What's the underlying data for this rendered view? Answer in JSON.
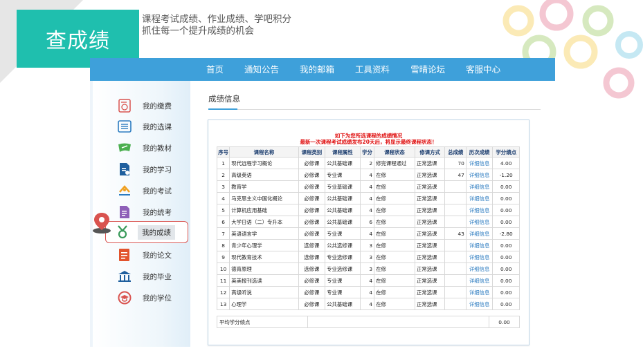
{
  "header": {
    "title": "查成绩",
    "subtitle_line1": "课程考试成绩、作业成绩、学吧积分",
    "subtitle_line2": "抓住每一个提升成绩的机会"
  },
  "nav": {
    "items": [
      "首页",
      "通知公告",
      "我的邮箱",
      "工具资料",
      "雪晴论坛",
      "客服中心"
    ]
  },
  "sidebar": {
    "items": [
      {
        "label": "我的缴费",
        "icon": "payment-icon"
      },
      {
        "label": "我的选课",
        "icon": "course-select-icon"
      },
      {
        "label": "我的教材",
        "icon": "textbook-icon"
      },
      {
        "label": "我的学习",
        "icon": "study-icon"
      },
      {
        "label": "我的考试",
        "icon": "exam-icon"
      },
      {
        "label": "我的统考",
        "icon": "unified-exam-icon"
      },
      {
        "label": "我的成绩",
        "icon": "medal-icon",
        "active": true
      },
      {
        "label": "我的论文",
        "icon": "thesis-icon"
      },
      {
        "label": "我的毕业",
        "icon": "graduation-building-icon"
      },
      {
        "label": "我的学位",
        "icon": "degree-cap-icon"
      }
    ],
    "accent": "#d9534f"
  },
  "content": {
    "tab_title": "成绩信息",
    "notice_line1": "如下为您所选课程的成绩情况",
    "notice_line2": "最新一次课程考试成绩发布20天后，将显示最终课程状态！",
    "columns": [
      "序号",
      "课程名称",
      "课程类别",
      "课程属性",
      "学分",
      "课程状态",
      "修课方式",
      "总成绩",
      "历次成绩",
      "学分绩点"
    ],
    "rows": [
      [
        "1",
        "现代远程学习概论",
        "必修课",
        "公共基础课",
        "2",
        "修完课程通过",
        "正常选课",
        "70",
        "详细信息",
        "4.00"
      ],
      [
        "2",
        "高级英语",
        "必修课",
        "专业课",
        "4",
        "在修",
        "正常选课",
        "47",
        "详细信息",
        "-1.20"
      ],
      [
        "3",
        "教育学",
        "必修课",
        "专业基础课",
        "4",
        "在修",
        "正常选课",
        "",
        "详细信息",
        "0.00"
      ],
      [
        "4",
        "马克思主义中国化概论",
        "必修课",
        "公共基础课",
        "4",
        "在修",
        "正常选课",
        "",
        "详细信息",
        "0.00"
      ],
      [
        "5",
        "计算机应用基础",
        "必修课",
        "公共基础课",
        "4",
        "在修",
        "正常选课",
        "",
        "详细信息",
        "0.00"
      ],
      [
        "6",
        "大学日语（二）专升本",
        "必修课",
        "公共基础课",
        "6",
        "在修",
        "正常选课",
        "",
        "详细信息",
        "0.00"
      ],
      [
        "7",
        "英语语言学",
        "必修课",
        "专业课",
        "4",
        "在修",
        "正常选课",
        "43",
        "详细信息",
        "-2.80"
      ],
      [
        "8",
        "青少年心理学",
        "选修课",
        "公共选修课",
        "3",
        "在修",
        "正常选课",
        "",
        "详细信息",
        "0.00"
      ],
      [
        "9",
        "现代教育技术",
        "选修课",
        "专业选修课",
        "3",
        "在修",
        "正常选课",
        "",
        "详细信息",
        "0.00"
      ],
      [
        "10",
        "德育原理",
        "选修课",
        "专业选修课",
        "3",
        "在修",
        "正常选课",
        "",
        "详细信息",
        "0.00"
      ],
      [
        "11",
        "英美报刊选读",
        "必修课",
        "专业课",
        "4",
        "在修",
        "正常选课",
        "",
        "详细信息",
        "0.00"
      ],
      [
        "12",
        "高级听说",
        "必修课",
        "专业课",
        "4",
        "在修",
        "正常选课",
        "",
        "详细信息",
        "0.00"
      ],
      [
        "13",
        "心理学",
        "必修课",
        "公共基础课",
        "4",
        "在修",
        "正常选课",
        "",
        "详细信息",
        "0.00"
      ]
    ],
    "avg_label": "平均学分绩点",
    "avg_value": "0.00"
  },
  "colors": {
    "title_bg": "#1fbfae",
    "nav_bg": "#3ea0da",
    "notice": "#e01010",
    "link": "#2b7bc0"
  }
}
